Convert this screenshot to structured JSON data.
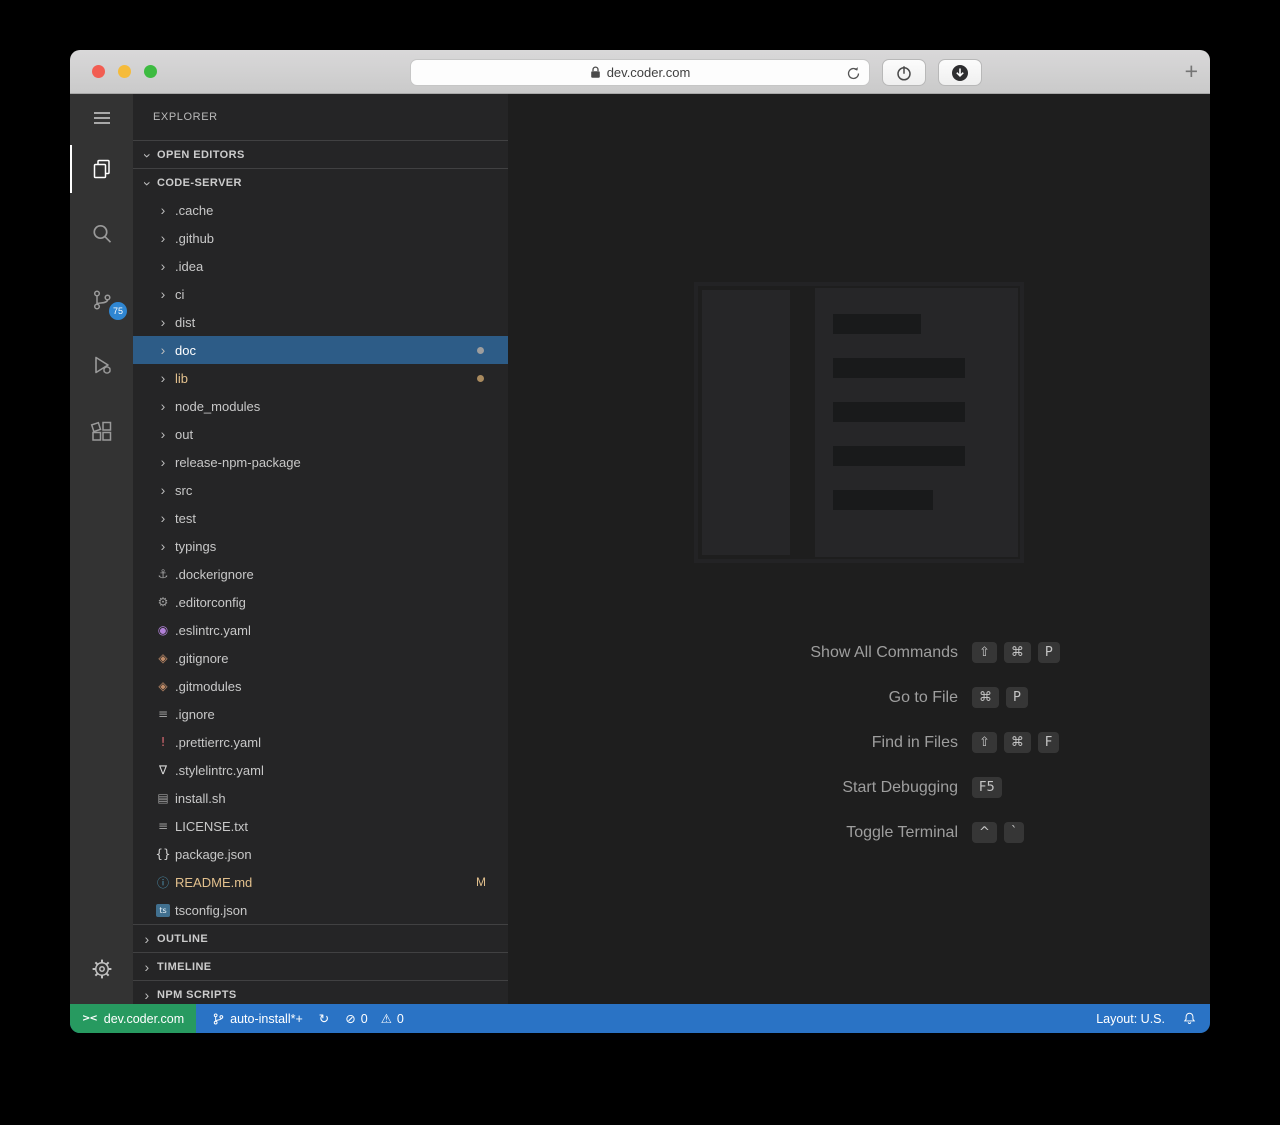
{
  "browser": {
    "url_host": "dev.coder.com",
    "new_tab_label": "+"
  },
  "activity_bar": {
    "scm_badge": "75"
  },
  "sidebar": {
    "title": "EXPLORER",
    "open_editors_label": "OPEN EDITORS",
    "root_label": "CODE-SERVER",
    "bottom_sections": [
      {
        "label": "OUTLINE"
      },
      {
        "label": "TIMELINE"
      },
      {
        "label": "NPM SCRIPTS"
      }
    ],
    "tree": [
      {
        "kind": "folder",
        "label": ".cache"
      },
      {
        "kind": "folder",
        "label": ".github"
      },
      {
        "kind": "folder",
        "label": ".idea"
      },
      {
        "kind": "folder",
        "label": "ci"
      },
      {
        "kind": "folder",
        "label": "dist"
      },
      {
        "kind": "folder",
        "label": "doc",
        "selected": true,
        "dot_color": "#9d9d9d"
      },
      {
        "kind": "folder",
        "label": "lib",
        "label_color": "#e2c08d",
        "dot_color": "#a98a5e"
      },
      {
        "kind": "folder",
        "label": "node_modules"
      },
      {
        "kind": "folder",
        "label": "out"
      },
      {
        "kind": "folder",
        "label": "release-npm-package"
      },
      {
        "kind": "folder",
        "label": "src"
      },
      {
        "kind": "folder",
        "label": "test"
      },
      {
        "kind": "folder",
        "label": "typings"
      },
      {
        "kind": "file",
        "label": ".dockerignore",
        "icon": "docker",
        "glyph": "⚓",
        "icon_color": "#9e9e9e"
      },
      {
        "kind": "file",
        "label": ".editorconfig",
        "icon": "editorconfig",
        "glyph": "⚙",
        "icon_color": "#9e9e9e"
      },
      {
        "kind": "file",
        "label": ".eslintrc.yaml",
        "icon": "eslint",
        "glyph": "◉",
        "icon_color": "#b180d7"
      },
      {
        "kind": "file",
        "label": ".gitignore",
        "icon": "git",
        "glyph": "◈",
        "icon_color": "#bd8a67"
      },
      {
        "kind": "file",
        "label": ".gitmodules",
        "icon": "git",
        "glyph": "◈",
        "icon_color": "#bd8a67"
      },
      {
        "kind": "file",
        "label": ".ignore",
        "icon": "ignore",
        "glyph": "≡",
        "icon_color": "#9e9e9e"
      },
      {
        "kind": "file",
        "label": ".prettierrc.yaml",
        "icon": "prettier",
        "glyph": "!",
        "icon_color": "#e06c75"
      },
      {
        "kind": "file",
        "label": ".stylelintrc.yaml",
        "icon": "stylelint",
        "glyph": "∇",
        "icon_color": "#d7d7d7"
      },
      {
        "kind": "file",
        "label": "install.sh",
        "icon": "shell",
        "glyph": "▤",
        "icon_color": "#9e9e9e"
      },
      {
        "kind": "file",
        "label": "LICENSE.txt",
        "icon": "text",
        "glyph": "≡",
        "icon_color": "#9e9e9e"
      },
      {
        "kind": "file",
        "label": "package.json",
        "icon": "json",
        "glyph": "{}",
        "icon_color": "#d4d4d4"
      },
      {
        "kind": "file",
        "label": "README.md",
        "icon": "info",
        "glyph": "ⓘ",
        "icon_color": "#519aba",
        "label_color": "#e2c08d",
        "badge": "M"
      },
      {
        "kind": "file",
        "label": "tsconfig.json",
        "icon": "ts",
        "glyph": "ts",
        "icon_color": "#e8f1f7"
      }
    ]
  },
  "editor": {
    "shortcuts": [
      {
        "label": "Show All Commands",
        "keys": [
          "⇧",
          "⌘",
          "P"
        ]
      },
      {
        "label": "Go to File",
        "keys": [
          "⌘",
          "P"
        ]
      },
      {
        "label": "Find in Files",
        "keys": [
          "⇧",
          "⌘",
          "F"
        ]
      },
      {
        "label": "Start Debugging",
        "keys": [
          "F5"
        ]
      },
      {
        "label": "Toggle Terminal",
        "keys": [
          "^",
          "`"
        ]
      }
    ]
  },
  "status_bar": {
    "remote_label": "dev.coder.com",
    "branch_label": "auto-install*+",
    "error_count": "0",
    "warning_count": "0",
    "layout_label": "Layout: U.S."
  },
  "icons": {
    "remote": "><",
    "sync": "↻",
    "error": "⊘",
    "warning": "⚠"
  },
  "colors": {
    "statusbar_bg": "#2a73c5",
    "remote_bg": "#279a60",
    "selection_bg": "#2d5c87",
    "badge_bg": "#2f86d2",
    "git_modified": "#e2c08d",
    "editor_bg": "#1e1e1e",
    "sidebar_bg": "#252526",
    "activity_bg": "#333333"
  }
}
